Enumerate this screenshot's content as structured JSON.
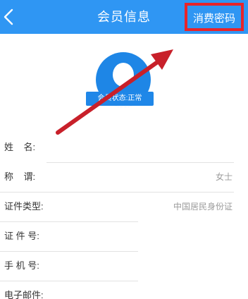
{
  "header": {
    "title": "会员信息",
    "action_label": "消费密码",
    "back_icon": "chevron-left-icon"
  },
  "profile": {
    "status_badge": "会员状态:正常",
    "avatar_icon": "user-avatar-icon"
  },
  "fields": [
    {
      "label": "姓    名:",
      "value": ""
    },
    {
      "label": "称    谓:",
      "value": "女士"
    },
    {
      "label": "证件类型:",
      "value": "中国居民身份证"
    },
    {
      "label": "证 件 号:",
      "value": ""
    },
    {
      "label": "手 机 号:",
      "value": ""
    },
    {
      "label": "电子邮件:",
      "value": ""
    }
  ],
  "colors": {
    "header_bg": "#2f96f3",
    "highlight_border": "#e8242a",
    "arrow": "#c8202a"
  }
}
